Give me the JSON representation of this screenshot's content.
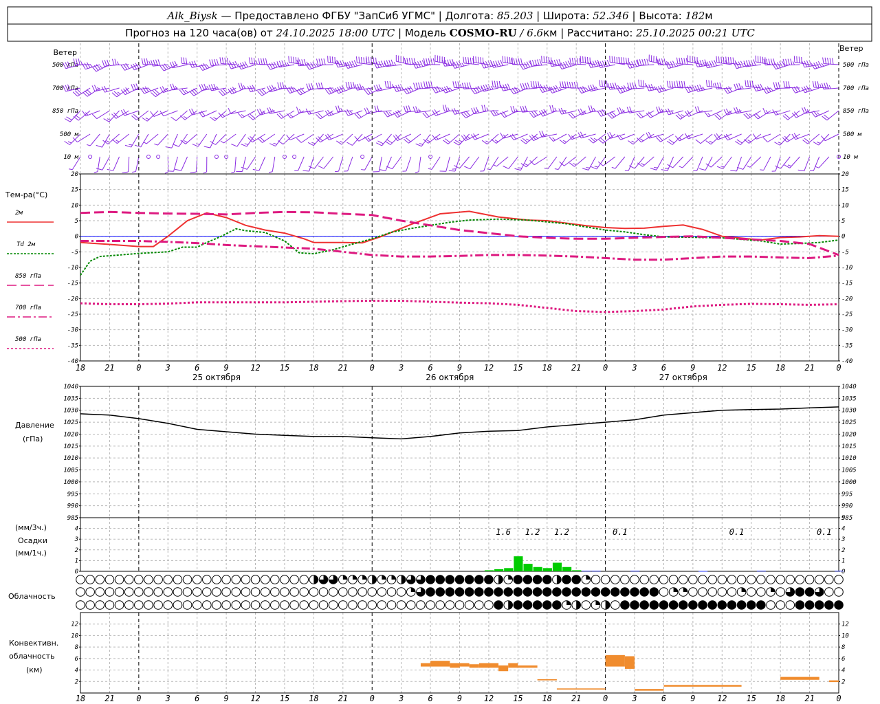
{
  "header": {
    "station": "Alk_Biysk",
    "provider": " — Предоставлено ФГБУ \"ЗапСиб УГМС\" | Долгота: ",
    "longitude": "85.203",
    "lat_label": " | Широта: ",
    "latitude": "52.346",
    "alt_label": " | Высота: ",
    "altitude": "182",
    "alt_unit": "м",
    "forecast_prefix": "Прогноз на 120 часа(ов) от ",
    "forecast_start": "24.10.2025 18:00 UTC",
    "model_label": "  | Модель ",
    "model_name": "COSMO-RU",
    "model_res_sep": " / ",
    "model_res": "6.6",
    "model_res_unit": "км",
    "calc_label": " | Рассчитано: ",
    "calc_time": "25.10.2025 00:21 UTC"
  },
  "labels": {
    "wind": "Ветер",
    "wind_levels": [
      "500 гПа",
      "700 гПа",
      "850 гПа",
      "500  м",
      "10  м"
    ],
    "temp_title": "Тем-ра(°C)",
    "legend": [
      {
        "label": "2м",
        "color": "#ee3030",
        "dash": ""
      },
      {
        "label": "Td  2м",
        "color": "#008800",
        "dash": "3 2"
      },
      {
        "label": "850 гПа",
        "color": "#dd1a80",
        "dash": "14 6"
      },
      {
        "label": "700 гПа",
        "color": "#dd1a80",
        "dash": "12 4 3 4"
      },
      {
        "label": "500 гПа",
        "color": "#dd1a80",
        "dash": "3 3"
      }
    ],
    "pressure_title": "Давление",
    "pressure_unit": "(гПа)",
    "precip_top": "(мм/3ч.)",
    "precip_title": "Осадки",
    "precip_unit": "(мм/1ч.)",
    "cloud_title": "Облачность",
    "conv_title_1": "Конвективн.",
    "conv_title_2": "облачность",
    "conv_unit": "(км)"
  },
  "time_axis": {
    "hours": [
      "18",
      "21",
      "0",
      "3",
      "6",
      "9",
      "12",
      "15",
      "18",
      "21",
      "0",
      "3",
      "6",
      "9",
      "12",
      "15",
      "18",
      "21",
      "0",
      "3",
      "6",
      "9",
      "12",
      "15",
      "18",
      "21",
      "0"
    ],
    "dates": [
      {
        "label": "25 октября",
        "at": 14
      },
      {
        "label": "26 октября",
        "at": 38
      },
      {
        "label": "27 октября",
        "at": 62
      }
    ],
    "span_hours": 78
  },
  "colors": {
    "wind": "#8a2be2",
    "grid": "#b8b8b8",
    "pressure": "#000000",
    "precip": "#00cc00",
    "convective": "#f08c2e",
    "zero_line": "#0000ff"
  },
  "chart_data": [
    {
      "type": "line",
      "name": "wind_barbs",
      "x_hours_step": 1,
      "levels": [
        "500 гПа",
        "700 гПа",
        "850 гПа",
        "500  м",
        "10  м"
      ],
      "note_units": "speed m/s, direction deg from which wind blows",
      "keyframes": {
        "500 гПа": [
          [
            0,
            255,
            12
          ],
          [
            12,
            260,
            14
          ],
          [
            24,
            265,
            18
          ],
          [
            36,
            270,
            20
          ],
          [
            48,
            265,
            22
          ],
          [
            60,
            270,
            20
          ],
          [
            78,
            265,
            18
          ]
        ],
        "700 гПа": [
          [
            0,
            245,
            10
          ],
          [
            12,
            250,
            12
          ],
          [
            24,
            255,
            13
          ],
          [
            36,
            260,
            15
          ],
          [
            48,
            260,
            17
          ],
          [
            60,
            265,
            15
          ],
          [
            78,
            260,
            13
          ]
        ],
        "850 гПа": [
          [
            0,
            235,
            7
          ],
          [
            12,
            240,
            6
          ],
          [
            24,
            250,
            8
          ],
          [
            36,
            255,
            10
          ],
          [
            48,
            255,
            11
          ],
          [
            60,
            250,
            9
          ],
          [
            78,
            245,
            8
          ]
        ],
        "500  м": [
          [
            0,
            225,
            5
          ],
          [
            12,
            215,
            4
          ],
          [
            24,
            235,
            6
          ],
          [
            36,
            230,
            7
          ],
          [
            48,
            245,
            8
          ],
          [
            60,
            240,
            7
          ],
          [
            78,
            235,
            6
          ]
        ],
        "10  м": [
          [
            0,
            200,
            3
          ],
          [
            12,
            190,
            2
          ],
          [
            24,
            210,
            3
          ],
          [
            36,
            200,
            3
          ],
          [
            48,
            225,
            4
          ],
          [
            60,
            215,
            4
          ],
          [
            78,
            210,
            3
          ]
        ]
      }
    },
    {
      "type": "line",
      "name": "temperature",
      "title": "Тем-ра(°C)",
      "x_unit": "hours from 24.10.2025 18 UTC",
      "ylim": [
        -40,
        20
      ],
      "yticks": [
        20,
        15,
        10,
        5,
        0,
        -5,
        -10,
        -15,
        -20,
        -25,
        -30,
        -35,
        -40
      ],
      "series": [
        {
          "name": "2м",
          "color": "#ee3030",
          "dash": "",
          "width": 2,
          "x": [
            0,
            3,
            6,
            7.5,
            9,
            11,
            13,
            15,
            17,
            19,
            21,
            23,
            24,
            27,
            29,
            31,
            34,
            37,
            40,
            43,
            46,
            48,
            50,
            52,
            54,
            56,
            58,
            60,
            62,
            64,
            66,
            68,
            70,
            72,
            74,
            76,
            78
          ],
          "y": [
            -2,
            -2.6,
            -3.3,
            -3.3,
            0,
            5,
            7.5,
            6,
            3.5,
            2,
            1,
            -0.8,
            -2,
            -2,
            -2.1,
            0,
            3.8,
            7.2,
            8,
            6.2,
            5.2,
            5,
            4.2,
            3.4,
            2.8,
            2.5,
            2.6,
            3.2,
            3.6,
            2.2,
            0,
            -0.6,
            -1.2,
            -0.4,
            -0.2,
            0.2,
            0
          ]
        },
        {
          "name": "Td  2м",
          "color": "#008800",
          "dash": "3 2",
          "width": 2,
          "x": [
            0,
            1,
            2,
            4,
            6,
            9,
            10.5,
            12,
            13,
            14.5,
            16,
            17,
            19,
            21,
            22.5,
            24,
            26,
            28,
            30,
            32,
            34,
            36,
            38,
            40,
            43,
            46,
            48,
            50,
            52,
            54,
            56,
            58,
            60,
            62,
            64,
            66,
            68,
            70,
            72,
            74,
            76,
            78
          ],
          "y": [
            -12.5,
            -8,
            -6.5,
            -6,
            -5.5,
            -5,
            -3.5,
            -3.5,
            -2,
            0,
            2.4,
            1.8,
            1.2,
            -1.5,
            -5.3,
            -5.6,
            -4.3,
            -2.5,
            -0.8,
            1.3,
            2.5,
            3.5,
            4.5,
            5.2,
            5.5,
            5.2,
            4.6,
            4,
            3,
            2,
            1.4,
            0.5,
            -0.2,
            -0.3,
            -0.4,
            -0.5,
            -1,
            -1.5,
            -2.5,
            -2.3,
            -2,
            -1.2
          ]
        },
        {
          "name": "850 гПа",
          "color": "#dd1a80",
          "dash": "14 6",
          "width": 3,
          "x": [
            0,
            3,
            6,
            9,
            12,
            15,
            18,
            21,
            24,
            27,
            30,
            33,
            36,
            39,
            42,
            45,
            48,
            51,
            54,
            57,
            60,
            63,
            66,
            69,
            72,
            75,
            78
          ],
          "y": [
            7.5,
            7.8,
            7.5,
            7.3,
            7.2,
            7,
            7.5,
            7.8,
            7.7,
            7.2,
            6.8,
            5,
            3.5,
            2,
            1,
            0,
            -0.5,
            -0.8,
            -0.8,
            -0.5,
            -0.2,
            0,
            -0.5,
            -1,
            -1.5,
            -2.5,
            -6
          ]
        },
        {
          "name": "700 гПа",
          "color": "#dd1a80",
          "dash": "12 4 3 4",
          "width": 3,
          "x": [
            0,
            3,
            6,
            9,
            12,
            15,
            18,
            21,
            24,
            27,
            30,
            33,
            36,
            39,
            42,
            45,
            48,
            51,
            54,
            57,
            60,
            63,
            66,
            69,
            72,
            75,
            78
          ],
          "y": [
            -1.5,
            -1.5,
            -1.5,
            -1.8,
            -2.2,
            -2.8,
            -3.2,
            -3.6,
            -4,
            -5,
            -6,
            -6.5,
            -6.5,
            -6.3,
            -6,
            -6,
            -6.2,
            -6.5,
            -7,
            -7.5,
            -7.5,
            -7,
            -6.5,
            -6.5,
            -6.8,
            -7,
            -6.2
          ]
        },
        {
          "name": "500 гПа",
          "color": "#dd1a80",
          "dash": "3 3",
          "width": 3,
          "x": [
            0,
            3,
            6,
            9,
            12,
            15,
            18,
            21,
            24,
            27,
            30,
            33,
            36,
            39,
            42,
            45,
            48,
            51,
            54,
            57,
            60,
            63,
            66,
            69,
            72,
            75,
            78
          ],
          "y": [
            -21.5,
            -21.8,
            -21.8,
            -21.6,
            -21.2,
            -21.2,
            -21.2,
            -21.2,
            -21,
            -20.8,
            -20.7,
            -20.7,
            -21,
            -21.3,
            -21.5,
            -22,
            -23,
            -24,
            -24.3,
            -24,
            -23.5,
            -22.5,
            -22,
            -21.7,
            -21.8,
            -22,
            -21.8
          ]
        }
      ]
    },
    {
      "type": "line",
      "name": "pressure",
      "title": "Давление",
      "ylabel": "(гПа)",
      "ylim": [
        985,
        1040
      ],
      "yticks": [
        1040,
        1035,
        1030,
        1025,
        1020,
        1015,
        1010,
        1005,
        1000,
        995,
        990,
        985
      ],
      "x": [
        0,
        3,
        6,
        9,
        12,
        15,
        18,
        21,
        24,
        27,
        30,
        33,
        36,
        39,
        42,
        45,
        48,
        51,
        54,
        57,
        60,
        63,
        66,
        69,
        72,
        75,
        78
      ],
      "y": [
        1028.5,
        1028,
        1026.5,
        1024.5,
        1022,
        1021,
        1020,
        1019.5,
        1019,
        1019,
        1018.5,
        1018,
        1019,
        1020.5,
        1021.2,
        1021.5,
        1023,
        1024,
        1025,
        1026,
        1028,
        1029,
        1030,
        1030.3,
        1030.5,
        1031,
        1031.4
      ]
    },
    {
      "type": "bar",
      "name": "precipitation",
      "title": "Осадки",
      "ylabel": "(мм/1ч.)",
      "ylim": [
        0,
        5
      ],
      "yticks": [
        5,
        4,
        3,
        2,
        1,
        0
      ],
      "x": [
        42,
        43,
        44,
        45,
        46,
        47,
        48,
        49,
        50,
        51,
        52,
        53,
        57,
        64,
        70,
        78
      ],
      "y": [
        0.1,
        0.2,
        0.3,
        1.4,
        0.7,
        0.4,
        0.3,
        0.8,
        0.4,
        0.1,
        0.05,
        0.05,
        0.05,
        0.03,
        0.05,
        0.05
      ],
      "totals_3h": [
        {
          "value": "1.6",
          "at": 43.5
        },
        {
          "value": "1.2",
          "at": 46.5
        },
        {
          "value": "1.2",
          "at": 49.5
        },
        {
          "value": "0.1",
          "at": 55.5
        },
        {
          "value": "0.1",
          "at": 67.5
        },
        {
          "value": "0.1",
          "at": 76.5
        }
      ]
    },
    {
      "type": "table",
      "name": "cloud_cover",
      "title": "Облачность",
      "rows_note": "fraction 0..1 per hour (0,1,...,78), rows: high, middle, low",
      "rows": [
        [
          0,
          0,
          0,
          0,
          0,
          0,
          0,
          0,
          0,
          0,
          0,
          0,
          0,
          0,
          0,
          0,
          0,
          0,
          0,
          0,
          0,
          0,
          0,
          0,
          0.5,
          0.75,
          0.75,
          0.25,
          0.25,
          0.25,
          0.5,
          0.25,
          0.25,
          0.5,
          0.75,
          0.75,
          1,
          1,
          1,
          1,
          1,
          1,
          1,
          0.5,
          0.25,
          1,
          1,
          1,
          1,
          0.5,
          1,
          1,
          0.25,
          0,
          0,
          0,
          0,
          0,
          0,
          0,
          0,
          0,
          0,
          0,
          0,
          0,
          0,
          0,
          0,
          0,
          0,
          0,
          0,
          0,
          0,
          0,
          0,
          0,
          0
        ],
        [
          0,
          0,
          0,
          0,
          0,
          0,
          0,
          0,
          0,
          0,
          0,
          0,
          0,
          0,
          0,
          0,
          0,
          0,
          0,
          0,
          0,
          0,
          0,
          0,
          0,
          0,
          0,
          0,
          0,
          0,
          0,
          0,
          0,
          0,
          0.25,
          0.75,
          1,
          1,
          1,
          1,
          1,
          1,
          1,
          1,
          1,
          1,
          1,
          1,
          1,
          1,
          1,
          1,
          1,
          1,
          1,
          1,
          1,
          1,
          1,
          1,
          0,
          0.25,
          0.25,
          0,
          0,
          0,
          0,
          0,
          0.25,
          0,
          0,
          0.25,
          0,
          0.75,
          1,
          1,
          0.75,
          0,
          0
        ],
        [
          0,
          0,
          0,
          0,
          0,
          0,
          0,
          0,
          0,
          0,
          0,
          0,
          0,
          0,
          0,
          0,
          0,
          0,
          0,
          0,
          0,
          0,
          0,
          0,
          0,
          0,
          0,
          0,
          0,
          0,
          0,
          0,
          0,
          0,
          0,
          0,
          0,
          0,
          0,
          0,
          0,
          0,
          0,
          1,
          0.5,
          1,
          1,
          1,
          1,
          1,
          0.25,
          0.5,
          0,
          0.25,
          0.5,
          0,
          1,
          1,
          1,
          1,
          1,
          1,
          1,
          1,
          1,
          1,
          1,
          1,
          1,
          1,
          1,
          0,
          0,
          0,
          1,
          1,
          1,
          1,
          1
        ]
      ]
    },
    {
      "type": "bar",
      "name": "convective_cloud",
      "title": "Конвективн. облачность",
      "ylabel": "(км)",
      "ylim": [
        0,
        14
      ],
      "yticks": [
        12,
        10,
        8,
        6,
        4,
        2,
        0
      ],
      "bars_note": "[from_hour, to_hour, base_km, top_km]",
      "bars": [
        [
          35,
          36,
          4.6,
          5.2
        ],
        [
          36,
          38,
          4.6,
          5.6
        ],
        [
          38,
          39,
          4.4,
          5.2
        ],
        [
          39,
          40,
          4.6,
          5.2
        ],
        [
          40,
          41,
          4.4,
          5
        ],
        [
          41,
          43,
          4.4,
          5.2
        ],
        [
          43,
          44,
          3.8,
          4.8
        ],
        [
          44,
          45,
          4.4,
          5.2
        ],
        [
          45,
          47,
          4.4,
          4.8
        ],
        [
          47,
          49,
          2.2,
          2.4
        ],
        [
          49,
          54,
          0.6,
          0.8
        ],
        [
          54,
          56,
          4.6,
          6.6
        ],
        [
          56,
          57,
          4.2,
          6.4
        ],
        [
          57,
          60,
          0.4,
          0.7
        ],
        [
          60,
          68,
          1.1,
          1.4
        ],
        [
          72,
          76,
          2.3,
          2.8
        ],
        [
          77,
          78,
          1.9,
          2.2
        ]
      ]
    }
  ]
}
